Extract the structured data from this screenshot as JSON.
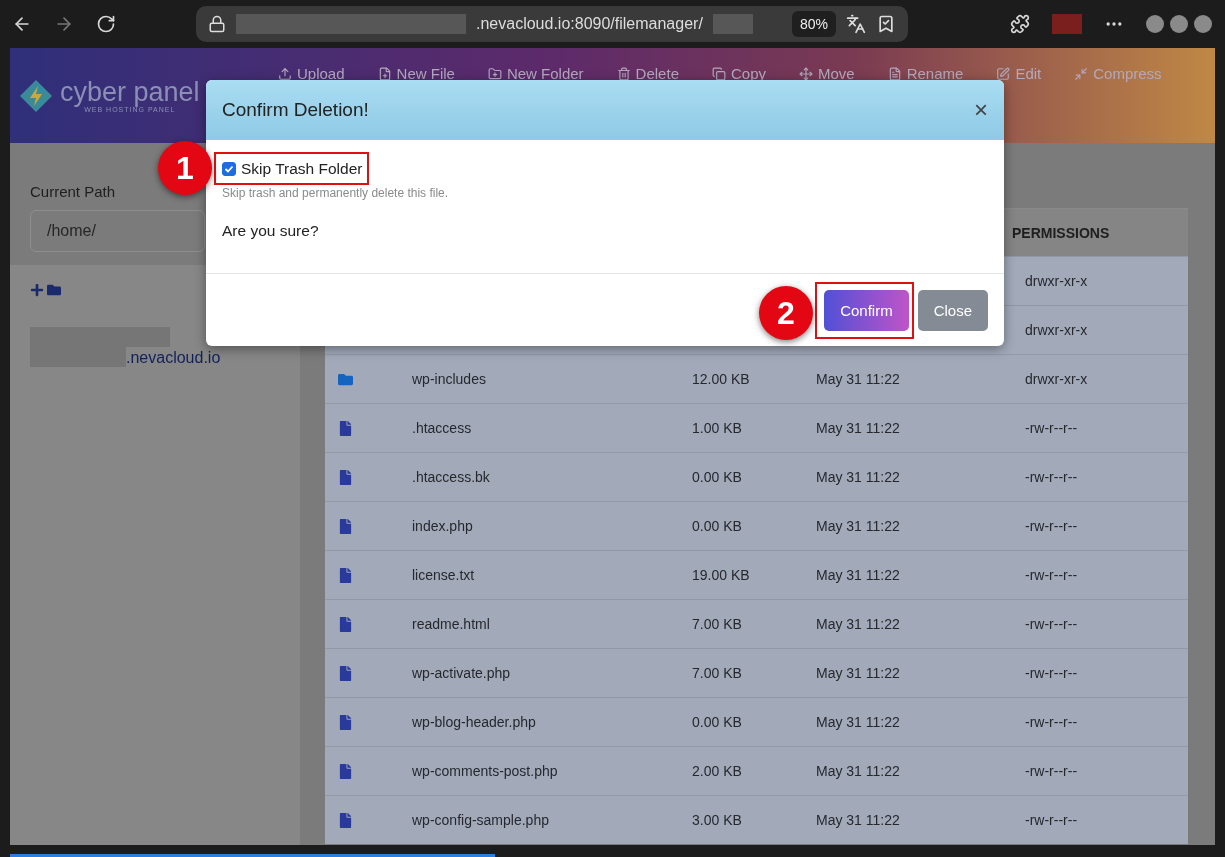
{
  "browser": {
    "address": ".nevacloud.io:8090/filemanager/",
    "zoom": "80%"
  },
  "header": {
    "logo": {
      "name": "cyber panel",
      "tagline": "WEB HOSTING PANEL"
    },
    "toolbar": [
      {
        "label": "Upload",
        "kind": "upload"
      },
      {
        "label": "New File",
        "kind": "new-file"
      },
      {
        "label": "New Folder",
        "kind": "new-folder"
      },
      {
        "label": "Delete",
        "kind": "delete"
      },
      {
        "label": "Copy",
        "kind": "copy"
      },
      {
        "label": "Move",
        "kind": "move"
      },
      {
        "label": "Rename",
        "kind": "rename"
      },
      {
        "label": "Edit",
        "kind": "edit"
      },
      {
        "label": "Compress",
        "kind": "compress"
      }
    ]
  },
  "sidebar": {
    "current_path_label": "Current Path",
    "path_value": "/home/",
    "tree_item": ".nevacloud.io"
  },
  "table": {
    "columns": [
      {
        "label": "PERMISSIONS"
      }
    ],
    "rows": [
      {
        "permissions": "drwxr-xr-x"
      },
      {
        "permissions": "drwxr-xr-x"
      },
      {
        "kind": "folder",
        "name": "wp-includes",
        "size": "12.00 KB",
        "modified": "May 31 11:22",
        "permissions": "drwxr-xr-x"
      },
      {
        "kind": "file",
        "name": ".htaccess",
        "size": "1.00 KB",
        "modified": "May 31 11:22",
        "permissions": "-rw-r--r--"
      },
      {
        "kind": "file",
        "name": ".htaccess.bk",
        "size": "0.00 KB",
        "modified": "May 31 11:22",
        "permissions": "-rw-r--r--"
      },
      {
        "kind": "file",
        "name": "index.php",
        "size": "0.00 KB",
        "modified": "May 31 11:22",
        "permissions": "-rw-r--r--"
      },
      {
        "kind": "file",
        "name": "license.txt",
        "size": "19.00 KB",
        "modified": "May 31 11:22",
        "permissions": "-rw-r--r--"
      },
      {
        "kind": "file",
        "name": "readme.html",
        "size": "7.00 KB",
        "modified": "May 31 11:22",
        "permissions": "-rw-r--r--"
      },
      {
        "kind": "file",
        "name": "wp-activate.php",
        "size": "7.00 KB",
        "modified": "May 31 11:22",
        "permissions": "-rw-r--r--"
      },
      {
        "kind": "file",
        "name": "wp-blog-header.php",
        "size": "0.00 KB",
        "modified": "May 31 11:22",
        "permissions": "-rw-r--r--"
      },
      {
        "kind": "file",
        "name": "wp-comments-post.php",
        "size": "2.00 KB",
        "modified": "May 31 11:22",
        "permissions": "-rw-r--r--"
      },
      {
        "kind": "file",
        "name": "wp-config-sample.php",
        "size": "3.00 KB",
        "modified": "May 31 11:22",
        "permissions": "-rw-r--r--"
      }
    ]
  },
  "modal": {
    "title": "Confirm Deletion!",
    "close": "×",
    "checkbox": {
      "label": "Skip Trash Folder",
      "checked": true
    },
    "hint": "Skip trash and permanently delete this file.",
    "question": "Are you sure?",
    "buttons": [
      {
        "label": "Confirm",
        "kind": "primary"
      },
      {
        "label": "Close",
        "kind": "secondary"
      }
    ]
  },
  "annotations": [
    {
      "number": "1"
    },
    {
      "number": "2"
    }
  ]
}
